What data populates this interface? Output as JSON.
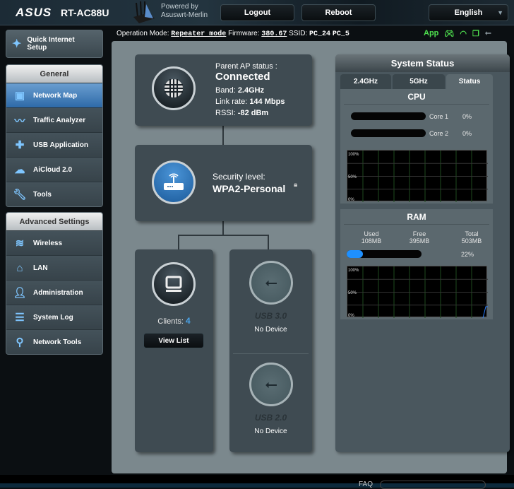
{
  "header": {
    "brand": "ASUS",
    "model": "RT-AC88U",
    "powered_by": "Powered by",
    "firmware_name": "Asuswrt-Merlin",
    "logout": "Logout",
    "reboot": "Reboot",
    "language": "English"
  },
  "info": {
    "op_mode_label": "Operation Mode:",
    "op_mode": "Repeater mode",
    "fw_label": "Firmware:",
    "fw": "380.67",
    "ssid_label": "SSID:",
    "ssid1": "PC_24",
    "ssid2": "PC_5",
    "app": "App"
  },
  "sidebar": {
    "quick": "Quick Internet Setup",
    "general": {
      "title": "General",
      "items": [
        {
          "label": "Network Map",
          "icon": "network-map-icon"
        },
        {
          "label": "Traffic Analyzer",
          "icon": "chart-icon"
        },
        {
          "label": "USB Application",
          "icon": "puzzle-icon"
        },
        {
          "label": "AiCloud 2.0",
          "icon": "cloud-icon"
        },
        {
          "label": "Tools",
          "icon": "wrench-icon"
        }
      ]
    },
    "advanced": {
      "title": "Advanced Settings",
      "items": [
        {
          "label": "Wireless",
          "icon": "wifi-icon"
        },
        {
          "label": "LAN",
          "icon": "home-icon"
        },
        {
          "label": "Administration",
          "icon": "user-icon"
        },
        {
          "label": "System Log",
          "icon": "log-icon"
        },
        {
          "label": "Network Tools",
          "icon": "search-icon"
        }
      ]
    }
  },
  "map": {
    "parent_label": "Parent AP status :",
    "parent_status": "Connected",
    "band_label": "Band:",
    "band": "2.4GHz",
    "rate_label": "Link rate:",
    "rate": "144 Mbps",
    "rssi_label": "RSSI:",
    "rssi": "-82 dBm",
    "security_label": "Security level:",
    "security": "WPA2-Personal",
    "clients_label": "Clients:",
    "clients": "4",
    "view_list": "View List",
    "usb3": "USB 3.0",
    "usb3_status": "No Device",
    "usb2": "USB 2.0",
    "usb2_status": "No Device"
  },
  "system": {
    "title": "System Status",
    "tabs": [
      "2.4GHz",
      "5GHz",
      "Status"
    ],
    "active_tab": "Status",
    "cpu": {
      "title": "CPU",
      "cores": [
        {
          "label": "Core 1",
          "value": "0%",
          "percent": 0
        },
        {
          "label": "Core 2",
          "value": "0%",
          "percent": 0
        }
      ],
      "axis": [
        "100%",
        "50%",
        "0%"
      ]
    },
    "ram": {
      "title": "RAM",
      "used_label": "Used",
      "used": "108MB",
      "free_label": "Free",
      "free": "395MB",
      "total_label": "Total",
      "total": "503MB",
      "percent_text": "22%",
      "percent": 22,
      "axis": [
        "100%",
        "50%",
        "0%"
      ]
    }
  },
  "footer": {
    "faq": "FAQ"
  },
  "colors": {
    "accent": "#2e6aa8",
    "ram_bar": "#1e90ff",
    "status_green": "#4ee04e",
    "clients_count": "#4aa3e8"
  }
}
